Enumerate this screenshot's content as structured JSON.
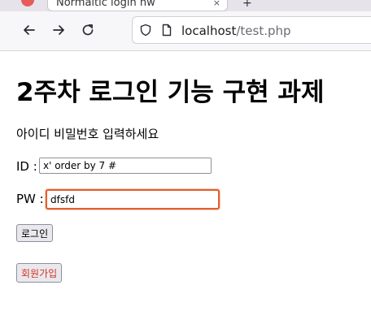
{
  "browser": {
    "tab_title": "Normaltic login hw",
    "tab_close": "×",
    "new_tab": "+",
    "url_host": "localhost",
    "url_path": "/test.php"
  },
  "page": {
    "heading": "2주차 로그인 기능 구현 과제",
    "prompt": "아이디 비밀번호 입력하세요",
    "id_label": "ID :",
    "id_value": "x' order by 7 #",
    "pw_label": "PW :",
    "pw_value": "dfsfd",
    "login_button": "로그인",
    "signup_button": "회원가입"
  },
  "colors": {
    "focus_ring": "#e35f2e",
    "signup_text": "#d93025"
  }
}
